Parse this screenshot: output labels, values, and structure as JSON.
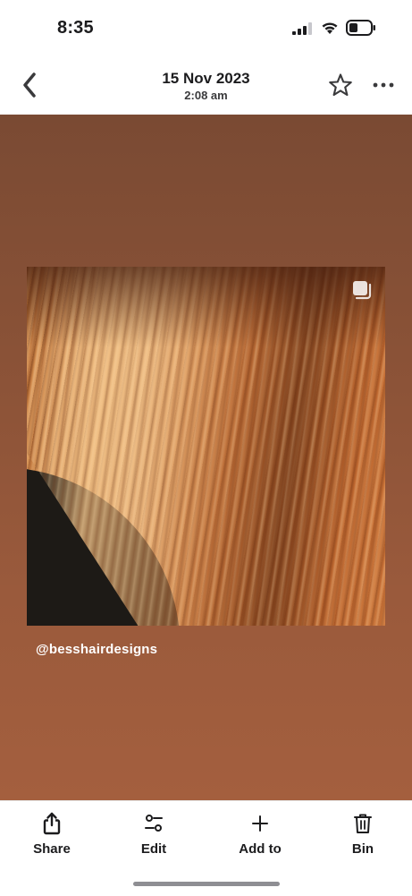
{
  "status_bar": {
    "time": "8:35"
  },
  "header": {
    "date": "15 Nov 2023",
    "time": "2:08 am"
  },
  "photo": {
    "handle": "@besshairdesigns"
  },
  "toolbar": {
    "share_label": "Share",
    "edit_label": "Edit",
    "add_label": "Add to",
    "bin_label": "Bin"
  },
  "colors": {
    "viewer_background": "#8a5237",
    "text_primary": "#1c1c1e",
    "home_indicator": "#8e8e93"
  },
  "icons": [
    "back-chevron-icon",
    "star-icon",
    "more-icon",
    "share-icon",
    "edit-icon",
    "add-icon",
    "bin-icon",
    "multiple-photos-icon",
    "signal-icon",
    "wifi-icon",
    "battery-icon"
  ]
}
